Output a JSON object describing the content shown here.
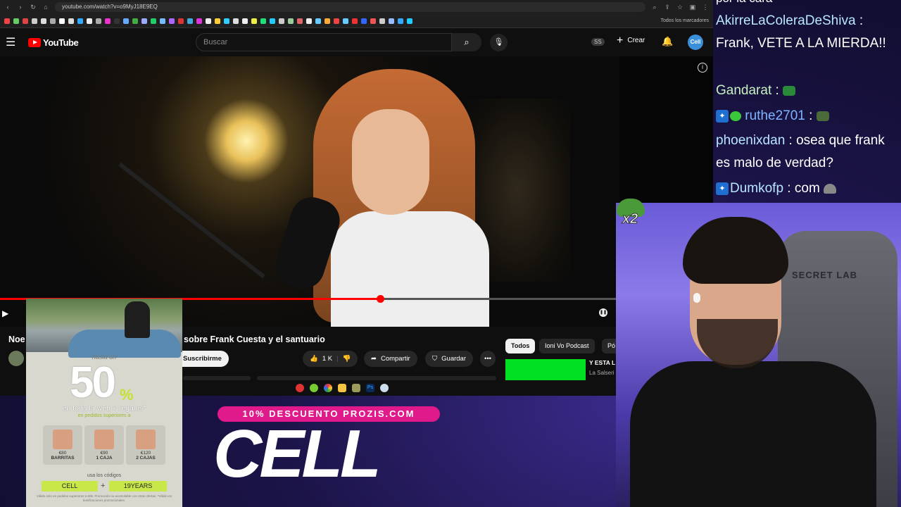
{
  "browser": {
    "url": "youtube.com/watch?v=o9MyJ18E9EQ",
    "bookmarks_folder": "Todos los marcadores",
    "bookmark_colors": [
      "#e44",
      "#6c6",
      "#d44",
      "#ccc",
      "#ddd",
      "#aaa",
      "#fff",
      "#ddd",
      "#3af",
      "#eee",
      "#aaa",
      "#e3c",
      "#333",
      "#6af",
      "#4a4",
      "#9af",
      "#2c6",
      "#7bf",
      "#a6f",
      "#d33",
      "#4ad",
      "#d3d",
      "#eee",
      "#fc3",
      "#3cf",
      "#ddd",
      "#eee",
      "#ee4",
      "#2d7",
      "#2cf",
      "#ccc",
      "#9c9",
      "#d66",
      "#eee",
      "#6cf",
      "#fa3",
      "#e44",
      "#6cf",
      "#e33",
      "#36f",
      "#e55",
      "#ccc",
      "#9bf",
      "#3af",
      "#2cf"
    ]
  },
  "youtube": {
    "logo": "YouTube",
    "search_placeholder": "Buscar",
    "ss_badge": "SS",
    "create_label": "Crear",
    "avatar_label": "Cell",
    "video_title": "sobre Frank Cuesta y el santuario",
    "title_start": "Noe",
    "subscribe_label": "Suscribirme",
    "likes": "1 K",
    "share_label": "Compartir",
    "save_label": "Guardar",
    "more_label": "•••",
    "progress": 0.617,
    "chips": [
      {
        "label": "Todos",
        "active": true
      },
      {
        "label": "Ioni Vo Podcast",
        "active": false
      },
      {
        "label": "Pó",
        "active": false
      }
    ],
    "rec_title": "Y ESTA L",
    "rec_channel": "La Salseri"
  },
  "chat": {
    "top_fragment": "por la cara",
    "messages": [
      {
        "user": "AkirreLaColeraDeShiva",
        "sep": " : ",
        "text": "Frank, VETE A LA MIERDA!!"
      },
      {
        "user": "Gandarat",
        "sep": " : ",
        "text": ""
      },
      {
        "user": "ruthe2701",
        "sep": " : ",
        "text": ""
      },
      {
        "user": "phoenixdan",
        "sep": " : ",
        "text": "osea que frank es malo de verdad?"
      },
      {
        "user": "Dumkofp",
        "sep": " : ",
        "text": "com"
      }
    ]
  },
  "overlay": {
    "multiplier": "x2",
    "chair_brand": "SECRET LAB"
  },
  "ad": {
    "hasta": "hasta un",
    "big": "50",
    "pct": "%",
    "line1": "en toda la web + regalos*",
    "line2": "en pedidos superiores a",
    "boxes": [
      {
        "price": "€80",
        "label": "BARRITAS"
      },
      {
        "price": "€90",
        "label": "1 CAJA"
      },
      {
        "price": "€120",
        "label": "2 CAJAS"
      }
    ],
    "use_codes": "usa los códigos",
    "code1": "CELL",
    "plus": "+",
    "code2": "19YEARS",
    "fine": "Válido solo en pedidos superiores a 60€. Promoción no acumulable con otras ofertas. *Válido en bonificaciones promocionales."
  },
  "promo": {
    "banner": "10% DESCUENTO PROZIS.COM",
    "brand": "CELL"
  }
}
